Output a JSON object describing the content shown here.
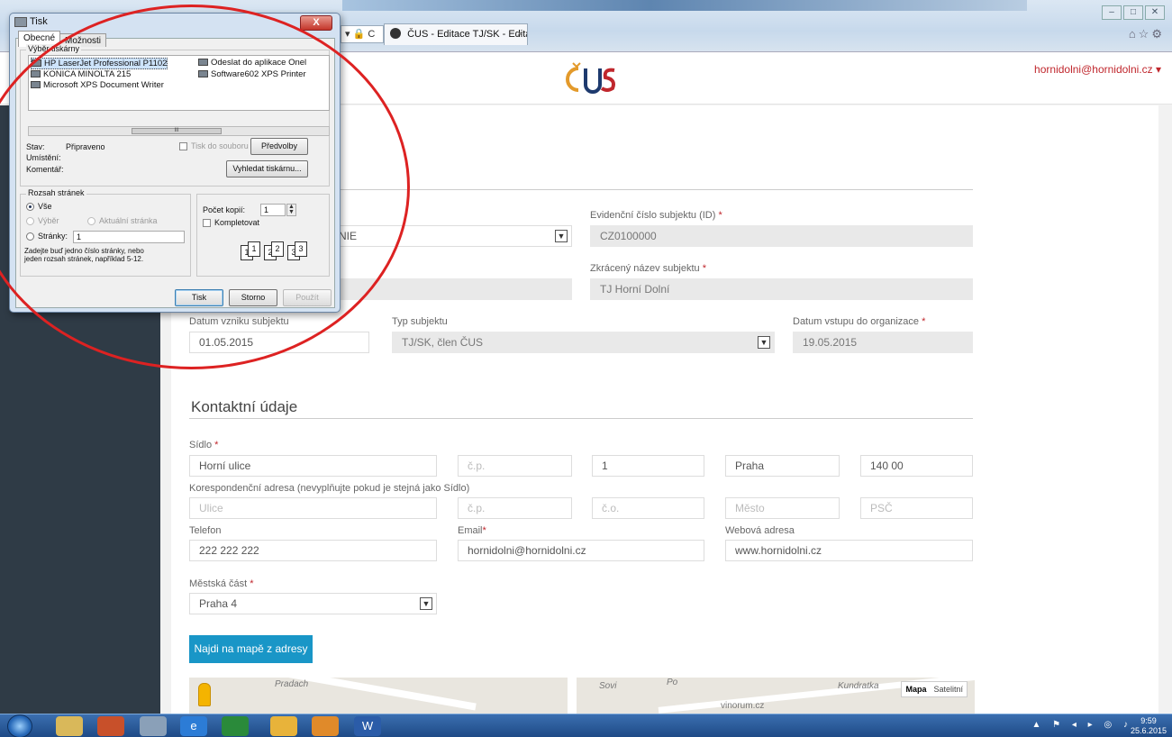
{
  "browser": {
    "address_tail": "▾ 🔒 C",
    "tab_title": "ČUS - Editace TJ/SK - Editac...",
    "tab_close": "×",
    "win_minimize": "–",
    "win_maximize": "□",
    "win_close": "✕",
    "fav_icons": "⌂☆⚙"
  },
  "header": {
    "logo_text": "ČUS",
    "user_menu": "hornidolni@hornidolni.cz ▾"
  },
  "form": {
    "id_label": "Evidenční číslo subjektu (ID)",
    "id_value": "CZ0100000",
    "org_partial": "NIE",
    "short_name_label": "Zkrácený název subjektu",
    "short_name_value": "TJ Horní Dolní",
    "founded_label": "Datum vzniku subjektu",
    "founded_value": "01.05.2015",
    "type_label": "Typ subjektu",
    "type_value": "TJ/SK, člen ČUS",
    "joined_label": "Datum vstupu do organizace",
    "joined_value": "19.05.2015",
    "required_mark": "*"
  },
  "contact": {
    "title": "Kontaktní údaje",
    "seat_label": "Sídlo",
    "seat": {
      "street": "Horní ulice",
      "cp_placeholder": "č.p.",
      "co": "1",
      "city": "Praha",
      "zip": "140 00"
    },
    "corr_label": "Korespondenční adresa (nevyplňujte pokud je stejná jako Sídlo)",
    "corr": {
      "street_ph": "Ulice",
      "cp_ph": "č.p.",
      "co_ph": "č.o.",
      "city_ph": "Město",
      "zip_ph": "PSČ"
    },
    "phone_label": "Telefon",
    "phone_value": "222 222 222",
    "email_label": "Email",
    "email_value": "hornidolni@hornidolni.cz",
    "web_label": "Webová adresa",
    "web_value": "www.hornidolni.cz",
    "district_label": "Městská část",
    "district_value": "Praha 4",
    "map_button": "Najdi na mapě z adresy"
  },
  "map": {
    "label1": "Pradach",
    "label2": "Kundratka",
    "label3": "vinorum.cz",
    "label4": "Sovi",
    "label5": "Po",
    "toggle_map": "Mapa",
    "toggle_sat": "Satelitní"
  },
  "dialog": {
    "title": "Tisk",
    "close": "X",
    "tab_general": "Obecné",
    "tab_options": "Možnosti",
    "printers_legend": "Výběr tiskárny",
    "printers": [
      "HP LaserJet Professional P1102",
      "KONICA MINOLTA 215",
      "Microsoft XPS Document Writer",
      "Odeslat do aplikace Onel",
      "Software602 XPS Printer"
    ],
    "scroll_mark": "III",
    "status_label": "Stav:",
    "status_value": "Připraveno",
    "location_label": "Umístění:",
    "comment_label": "Komentář:",
    "print_to_file": "Tisk do souboru",
    "preferences": "Předvolby",
    "find_printer": "Vyhledat tiskárnu...",
    "range_legend": "Rozsah stránek",
    "range_all": "Vše",
    "range_selection": "Výběr",
    "range_current": "Aktuální stránka",
    "range_pages": "Stránky:",
    "range_pages_value": "1",
    "range_hint1": "Zadejte buď jedno číslo stránky, nebo",
    "range_hint2": "jeden rozsah stránek, například 5-12.",
    "copies_label": "Počet kopií:",
    "copies_value": "1",
    "collate": "Kompletovat",
    "collate_pages": [
      "1",
      "1",
      "2",
      "2",
      "3",
      "3"
    ],
    "btn_print": "Tisk",
    "btn_cancel": "Storno",
    "btn_apply": "Použít"
  },
  "taskbar": {
    "tray_icons": "▲ ⚑ ◂ ▸ ◎ ♪",
    "time": "9:59",
    "date": "25.6.2015"
  }
}
